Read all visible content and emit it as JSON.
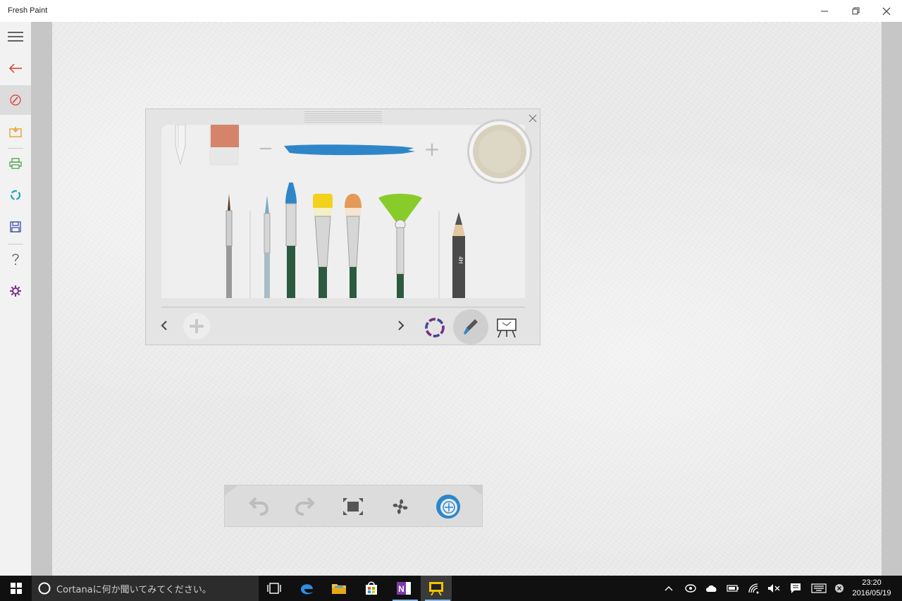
{
  "window": {
    "title": "Fresh Paint"
  },
  "sidebar": {
    "items": [
      {
        "icon": "hamburger-menu-icon"
      },
      {
        "icon": "back-arrow-icon",
        "color": "#d63b2f"
      },
      {
        "icon": "brush-tool-icon",
        "color": "#d63b2f",
        "active": true
      },
      {
        "icon": "import-icon",
        "color": "#e89a1f"
      },
      {
        "icon": "print-icon",
        "color": "#3b9a3b"
      },
      {
        "icon": "share-icon",
        "color": "#1ba1c7"
      },
      {
        "icon": "save-icon",
        "color": "#3b4aa8"
      },
      {
        "icon": "help-icon",
        "color": "#555555"
      },
      {
        "icon": "settings-icon",
        "color": "#7a2d8a"
      }
    ]
  },
  "palette": {
    "current_color": "#d7d0bd",
    "stroke_color": "#2e86c9",
    "brush_size_minus": "−",
    "brush_size_plus": "+",
    "pencil_label": "4H"
  },
  "bottom_toolbar": {
    "buttons": [
      "undo",
      "redo",
      "fit-to-screen",
      "dry-fan",
      "paint-mode"
    ]
  },
  "taskbar": {
    "search_placeholder": "Cortanaに何か聞いてみてください。",
    "time": "23:20",
    "date": "2016/05/19"
  }
}
